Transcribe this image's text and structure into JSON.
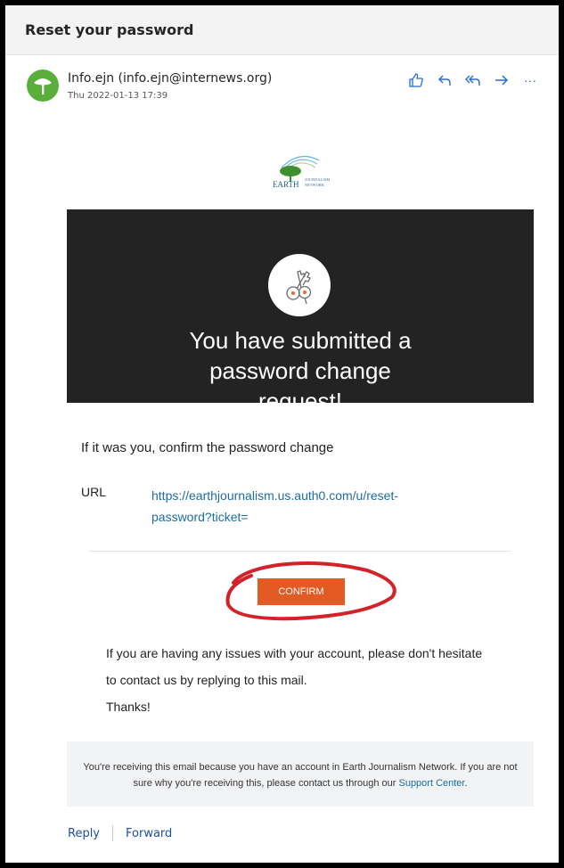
{
  "email": {
    "subject": "Reset your password",
    "sender": "Info.ejn (info.ejn@internews.org)",
    "date": "Thu 2022-01-13 17:39"
  },
  "toolbar": {
    "icons": [
      "like-icon",
      "reply-icon",
      "reply-all-icon",
      "forward-icon",
      "more-icon"
    ],
    "more_label": "···"
  },
  "logo": {
    "line1": "EARTH",
    "line2": "JOURNALISM",
    "line3": "NETWORK"
  },
  "hero": {
    "title": "You have submitted a password change request!"
  },
  "body": {
    "confirm_prompt": "If it was you, confirm the password change",
    "url_label": "URL",
    "url_value": "https://earthjournalism.us.auth0.com/u/reset-password?ticket=",
    "confirm_button": "CONFIRM",
    "issues_line1": "If you are having any issues with your account, please don't hesitate",
    "issues_line2": "to contact us by replying to this mail.",
    "thanks": "Thanks!"
  },
  "footer": {
    "text": "You're receiving this email because you have an account in Earth Journalism Network. If you are not sure why you're receiving this, please contact us through our",
    "link": "Support Center",
    "end": "."
  },
  "reply_bar": {
    "reply": "Reply",
    "forward": "Forward"
  },
  "colors": {
    "hero_bg": "#232324",
    "button": "#e35a24",
    "link": "#1c6ca1",
    "annotation": "#d2232a",
    "icon_blue": "#2a6bd0"
  }
}
